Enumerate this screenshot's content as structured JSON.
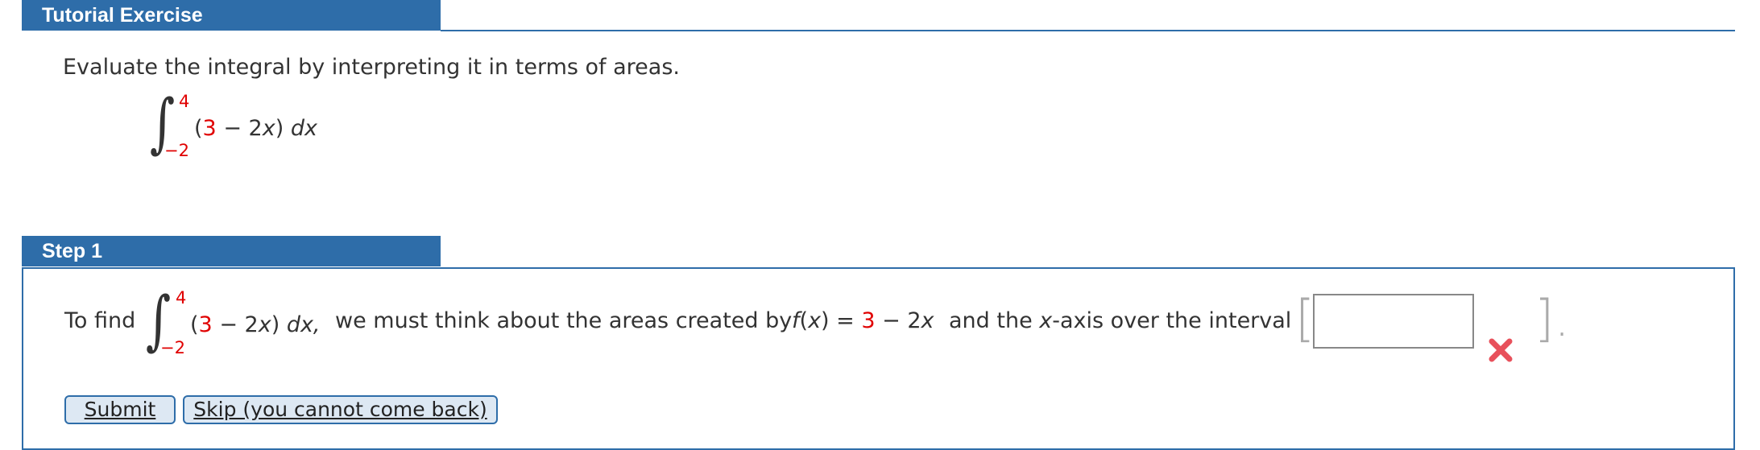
{
  "tutorial": {
    "header": "Tutorial Exercise",
    "instruction": "Evaluate the integral by interpreting it in terms of areas.",
    "integral": {
      "upper": "4",
      "lower": "−2",
      "open_paren": "(",
      "constant": "3",
      "rest": " − 2",
      "var": "x",
      "close": ") ",
      "dx": "dx"
    }
  },
  "step": {
    "header": "Step 1",
    "to_find": "To find",
    "integral": {
      "upper": "4",
      "lower": "−2",
      "open_paren": "(",
      "constant": "3",
      "rest": " − 2",
      "var": "x",
      "close": ") ",
      "dx": "dx,"
    },
    "sentence_mid": "we must think about the areas created by",
    "function": {
      "f": "f",
      "open": "(",
      "x": "x",
      "close_eq": ") = ",
      "constant": "3",
      "rest": " − 2",
      "var": "x"
    },
    "sentence_end_a": "and the ",
    "sentence_end_x": "x",
    "sentence_end_b": "-axis over the interval",
    "bracket_open": "[",
    "bracket_close": "].",
    "answer": {
      "value": "",
      "placeholder": "",
      "status": "incorrect",
      "status_color": "#e8505b"
    }
  },
  "buttons": {
    "submit": "Submit",
    "skip": "Skip (you cannot come back)"
  },
  "colors": {
    "header": "#2e6da9",
    "accent_red": "#e00000"
  }
}
